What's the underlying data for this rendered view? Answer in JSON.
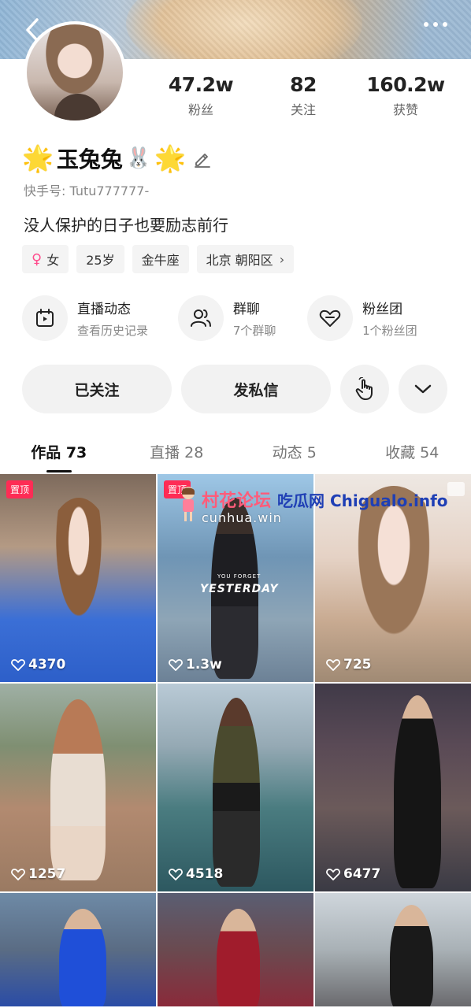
{
  "profile": {
    "nickname": "玉兔兔",
    "star_left": "🌟",
    "star_right": "🌟",
    "rabbit": "🐰",
    "uid": "快手号: Tutu777777-",
    "bio": "没人保护的日子也要励志前行",
    "stats": [
      {
        "value": "47.2w",
        "label": "粉丝"
      },
      {
        "value": "82",
        "label": "关注"
      },
      {
        "value": "160.2w",
        "label": "获赞"
      }
    ],
    "tags": {
      "gender_symbol": "♀",
      "gender": "女",
      "age": "25岁",
      "zodiac": "金牛座",
      "location": "北京 朝阳区",
      "location_chevron": "›"
    }
  },
  "features": [
    {
      "title": "直播动态",
      "subtitle": "查看历史记录",
      "icon": "live-calendar-icon"
    },
    {
      "title": "群聊",
      "subtitle": "7个群聊",
      "icon": "group-chat-icon"
    },
    {
      "title": "粉丝团",
      "subtitle": "1个粉丝团",
      "icon": "fan-club-heart-icon"
    }
  ],
  "actions": {
    "followed": "已关注",
    "message": "发私信"
  },
  "tabs": [
    {
      "label": "作品 73"
    },
    {
      "label": "直播 28"
    },
    {
      "label": "动态 5"
    },
    {
      "label": "收藏 54"
    }
  ],
  "grid": [
    {
      "likes": "4370",
      "pinned": "置顶"
    },
    {
      "likes": "1.3w",
      "pinned": "置顶",
      "caption_small": "YOU FORGET",
      "caption": "YESTERDAY"
    },
    {
      "likes": "725"
    },
    {
      "likes": "1257"
    },
    {
      "likes": "4518"
    },
    {
      "likes": "6477"
    },
    {},
    {},
    {}
  ],
  "watermark": {
    "forum": "村花论坛",
    "site": "吃瓜网 Chigualo.info",
    "domain": "cunhua.win"
  },
  "colors": {
    "accent_pink": "#fe2c55",
    "star": "#ffc21a",
    "female": "#ff4d8d"
  }
}
